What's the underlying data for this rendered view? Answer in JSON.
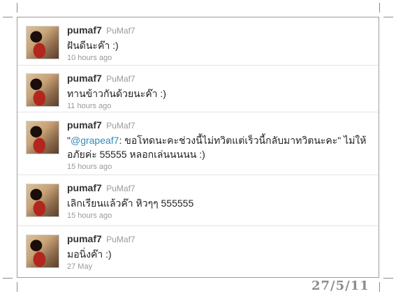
{
  "tweets": [
    {
      "screen_name": "pumaf7",
      "name": "PuMaf7",
      "text": "ฝันดีนะค๊า :)",
      "time": "10 hours ago"
    },
    {
      "screen_name": "pumaf7",
      "name": "PuMaf7",
      "text": "ทานข้าวกันด้วยนะค๊า :)",
      "time": "11 hours ago"
    },
    {
      "screen_name": "pumaf7",
      "name": "PuMaf7",
      "text_prefix": "\"",
      "mention": "@grapeaf7",
      "text": ": ขอโทดนะคะช่วงนี้ไม่ทวิตแต่เร็วนี้กลับมาทวิตนะคะ\" ไม่ให้อภัยค่ะ 55555 หลอกเล่นนนนน :)",
      "time": "15 hours ago"
    },
    {
      "screen_name": "pumaf7",
      "name": "PuMaf7",
      "text": "เลิกเรียนแล้วค๊า หิวๆๆ 555555",
      "time": "15 hours ago"
    },
    {
      "screen_name": "pumaf7",
      "name": "PuMaf7",
      "text": "มอนิ่งค๊า :)",
      "time": "27 May"
    }
  ],
  "date_stamp": "27/5/11",
  "colors": {
    "mention": "#3388bb",
    "screen_name": "#333333",
    "meta": "#999999"
  }
}
